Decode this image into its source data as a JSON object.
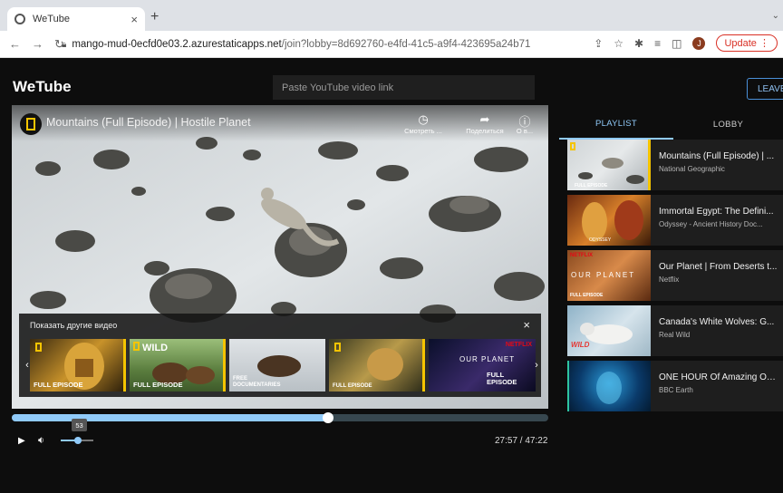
{
  "browser": {
    "tab_title": "WeTube",
    "tab_close": "×",
    "new_tab": "+",
    "tab_menu": "⌄",
    "url_host": "mango-mud-0ecfd0e03.2.azurestaticapps.net",
    "url_path": "/join?lobby=8d692760-e4fd-41c5-a9f4-423695a24b71",
    "profile_initial": "J",
    "update_label": "Update"
  },
  "app": {
    "logo": "WeTube",
    "url_placeholder": "Paste YouTube video link",
    "leave_label": "LEAVE"
  },
  "player": {
    "title": "Mountains (Full Episode) | Hostile Planet",
    "actions": [
      {
        "label": "Смотреть ...",
        "icon": "clock-icon"
      },
      {
        "label": "Поделиться",
        "icon": "share-icon"
      },
      {
        "label": "О в...",
        "icon": "info-icon"
      }
    ],
    "more_videos_title": "Показать другие видео",
    "more_close": "×",
    "more_thumbs": [
      {
        "label": "FULL EPISODE",
        "badge": ""
      },
      {
        "label": "FULL EPISODE",
        "badge": "WILD"
      },
      {
        "label": "FREE DOCUMENTARIES",
        "badge": ""
      },
      {
        "label": "FULL EPISODE",
        "badge": ""
      },
      {
        "label": "FULL EPISODE",
        "badge": "NETFLIX",
        "extra": "OUR PLANET"
      }
    ],
    "progress": 0.589,
    "volume": 53,
    "volume_tip": "53",
    "time": "27:57 / 47:22"
  },
  "sidebar": {
    "tabs": [
      {
        "label": "PLAYLIST",
        "active": true
      },
      {
        "label": "LOBBY",
        "active": false
      }
    ],
    "playlist": [
      {
        "title": "Mountains (Full Episode) | ...",
        "channel": "National Geographic",
        "thumb_text": "FULL EPISODE"
      },
      {
        "title": "Immortal Egypt: The Defini...",
        "channel": "Odyssey - Ancient History Doc...",
        "thumb_text": "ODYSSEY"
      },
      {
        "title": "Our Planet | From Deserts t...",
        "channel": "Netflix",
        "thumb_text": "OUR PLANET",
        "badge": "NETFLIX",
        "sub_badge": "FULL EPISODE"
      },
      {
        "title": "Canada's White Wolves: G...",
        "channel": "Real Wild",
        "thumb_text": "WILD"
      },
      {
        "title": "ONE HOUR Of Amazing Oc...",
        "channel": "BBC Earth",
        "thumb_text": ""
      }
    ]
  },
  "colors": {
    "accent": "#90caf9",
    "background": "#0d0d0d",
    "leave_border": "#4a90d9",
    "natgeo_yellow": "#f5c400",
    "netflix_red": "#e50914"
  }
}
